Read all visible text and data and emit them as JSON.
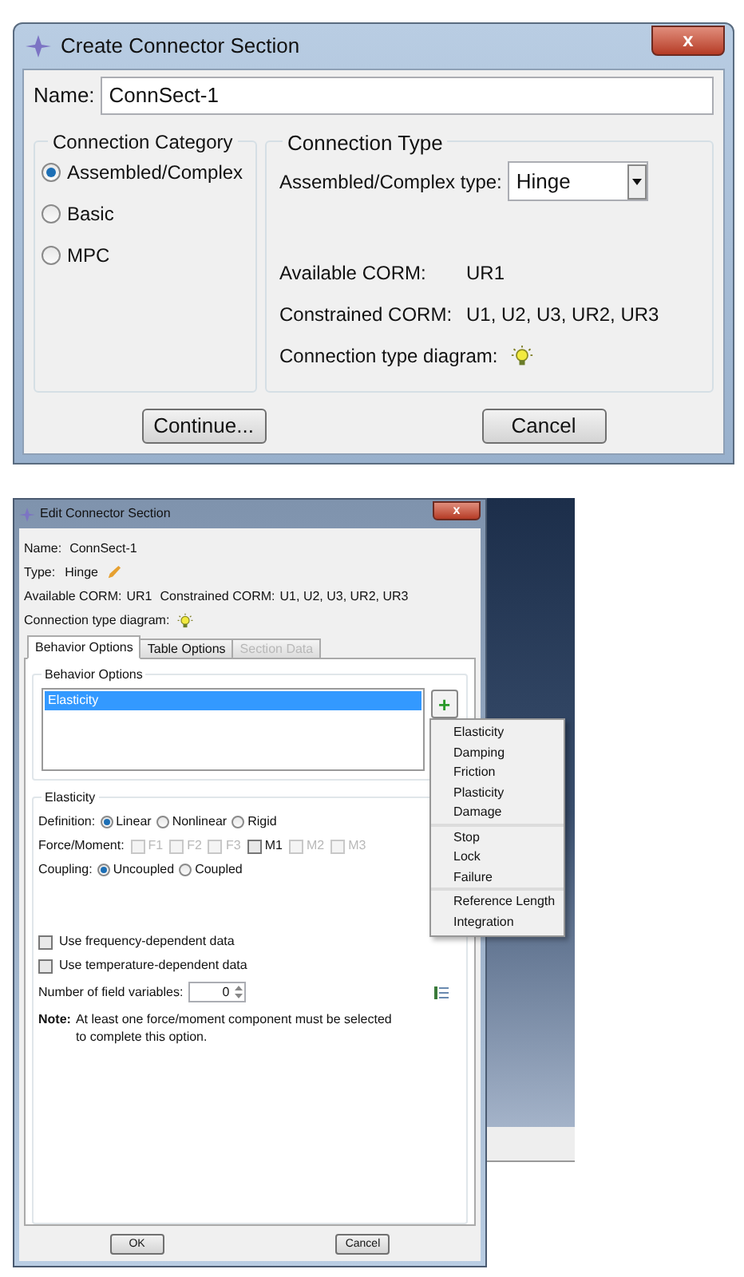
{
  "create_dialog": {
    "title": "Create Connector Section",
    "close": "x",
    "name_label": "Name:",
    "name_value": "ConnSect-1",
    "category": {
      "title": "Connection Category",
      "options": [
        {
          "label": "Assembled/Complex",
          "selected": true
        },
        {
          "label": "Basic",
          "selected": false
        },
        {
          "label": "MPC",
          "selected": false
        }
      ]
    },
    "type": {
      "title": "Connection Type",
      "type_label": "Assembled/Complex type:",
      "type_value": "Hinge",
      "available_label": "Available CORM:",
      "available_value": "UR1",
      "constrained_label": "Constrained CORM:",
      "constrained_value": "U1, U2, U3, UR2, UR3",
      "diagram_label": "Connection type diagram:"
    },
    "buttons": [
      "Continue...",
      "Cancel"
    ]
  },
  "edit_dialog": {
    "title": "Edit Connector Section",
    "close": "x",
    "name_label": "Name:",
    "name_value": "ConnSect-1",
    "type_label": "Type:",
    "type_value": "Hinge",
    "available_label": "Available CORM:",
    "available_value": "UR1",
    "constrained_label": "Constrained CORM:",
    "constrained_value": "U1, U2, U3, UR2, UR3",
    "diagram_label": "Connection type diagram:",
    "tabs": [
      {
        "label": "Behavior Options",
        "selected": true,
        "disabled": false
      },
      {
        "label": "Table Options",
        "selected": false,
        "disabled": false
      },
      {
        "label": "Section Data",
        "selected": false,
        "disabled": true
      }
    ],
    "behavior_group": "Behavior Options",
    "behaviors": [
      {
        "label": "Elasticity",
        "selected": true
      }
    ],
    "add_button": "+",
    "add_menu": [
      {
        "items": [
          "Elasticity",
          "Damping",
          "Friction",
          "Plasticity",
          "Damage"
        ]
      },
      {
        "items": [
          "Stop",
          "Lock",
          "Failure"
        ]
      },
      {
        "items": [
          "Reference Length",
          "Integration"
        ]
      }
    ],
    "elasticity": {
      "title": "Elasticity",
      "definition_label": "Definition:",
      "definition": [
        {
          "label": "Linear",
          "selected": true
        },
        {
          "label": "Nonlinear",
          "selected": false
        },
        {
          "label": "Rigid",
          "selected": false
        }
      ],
      "force_label": "Force/Moment:",
      "components": [
        {
          "label": "F1",
          "checked": false,
          "disabled": true
        },
        {
          "label": "F2",
          "checked": false,
          "disabled": true
        },
        {
          "label": "F3",
          "checked": false,
          "disabled": true
        },
        {
          "label": "M1",
          "checked": false,
          "disabled": false
        },
        {
          "label": "M2",
          "checked": false,
          "disabled": true
        },
        {
          "label": "M3",
          "checked": false,
          "disabled": true
        }
      ],
      "coupling_label": "Coupling:",
      "coupling": [
        {
          "label": "Uncoupled",
          "selected": true
        },
        {
          "label": "Coupled",
          "selected": false
        }
      ]
    },
    "options": [
      {
        "label": "Use frequency-dependent data",
        "checked": false
      },
      {
        "label": "Use temperature-dependent data",
        "checked": false
      }
    ],
    "field_variables_label": "Number of field variables:",
    "field_variables_value": "0",
    "note_label": "Note:",
    "note_text": "At least one force/moment component must be selected to complete this option.",
    "buttons": [
      "OK",
      "Cancel"
    ]
  }
}
